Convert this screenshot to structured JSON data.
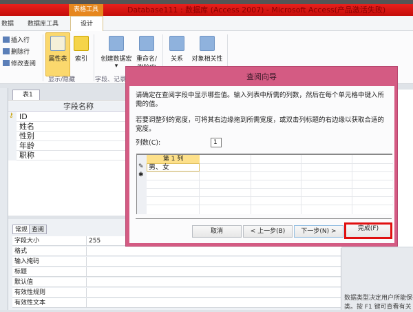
{
  "titlebar": {
    "context_tab": "表格工具",
    "title": "Database111 : 数据库 (Access 2007) - Microsoft Access(产品激活失败)"
  },
  "ribbon_tabs": [
    "数据",
    "数据库工具",
    "设计"
  ],
  "ribbon": {
    "small": [
      "插入行",
      "删除行",
      "修改查阅"
    ],
    "big": [
      "属性表",
      "索引",
      "创建数据宏",
      "重命名/删除宏",
      "关系",
      "对象相关性"
    ],
    "groups": [
      "显示/隐藏",
      "字段、记录"
    ]
  },
  "doc_tab": "表1",
  "grid": {
    "header": "字段名称",
    "fields": [
      "ID",
      "姓名",
      "性别",
      "年龄",
      "职称"
    ]
  },
  "props": {
    "tabs": [
      "常规",
      "查阅"
    ],
    "rows": [
      {
        "k": "字段大小",
        "v": "255"
      },
      {
        "k": "格式",
        "v": ""
      },
      {
        "k": "输入掩码",
        "v": ""
      },
      {
        "k": "标题",
        "v": ""
      },
      {
        "k": "默认值",
        "v": ""
      },
      {
        "k": "有效性规则",
        "v": ""
      },
      {
        "k": "有效性文本",
        "v": ""
      }
    ]
  },
  "help": [
    "数据类型决定用户所能保存",
    "类。按 F1 键可查看有关"
  ],
  "dialog": {
    "title": "查阅向导",
    "msg1": "请确定在查阅字段中显示哪些值。输入列表中所需的列数，然后在每个单元格中键入所需的值。",
    "msg2": "若要调整列的宽度，可将其右边缘拖到所需宽度，或双击列标题的右边缘以获取合适的宽度。",
    "col_label": "列数(C):",
    "col_value": "1",
    "col_header": "第 1 列",
    "cell_value": "男、女",
    "buttons": {
      "cancel": "取消",
      "back": "< 上一步(B)",
      "next": "下一步(N) >",
      "finish": "完成(F)"
    }
  }
}
